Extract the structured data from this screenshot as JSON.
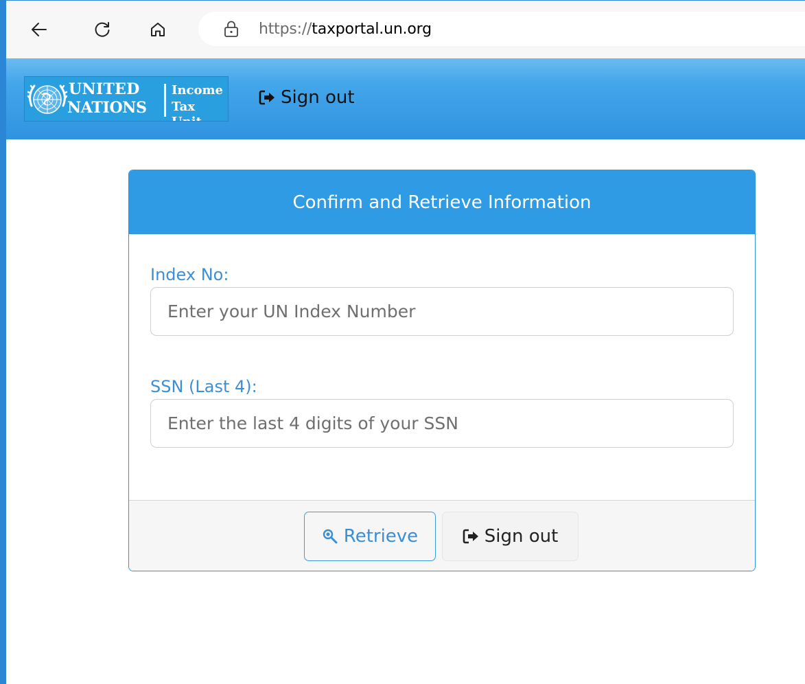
{
  "browser": {
    "url_scheme": "https://",
    "url_host": "taxportal.un.org"
  },
  "header": {
    "logo_line1": "UNITED",
    "logo_line2": "NATIONS",
    "logo_sub1": "Income",
    "logo_sub2": "Tax Unit",
    "signout_label": "Sign out"
  },
  "card": {
    "title": "Confirm and Retrieve Information",
    "index_label": "Index No:",
    "index_placeholder": "Enter your UN Index Number",
    "ssn_label": "SSN (Last 4):",
    "ssn_placeholder": "Enter the last 4 digits of your SSN",
    "retrieve_label": "Retrieve",
    "signout_label": "Sign out"
  },
  "icons": {
    "back": "arrow-left-icon",
    "reload": "reload-icon",
    "home": "home-icon",
    "lock": "lock-icon",
    "signout": "sign-out-icon",
    "retrieve": "magnifier-icon"
  },
  "colors": {
    "accent": "#2f9be4",
    "label_blue": "#3d8fd4"
  }
}
